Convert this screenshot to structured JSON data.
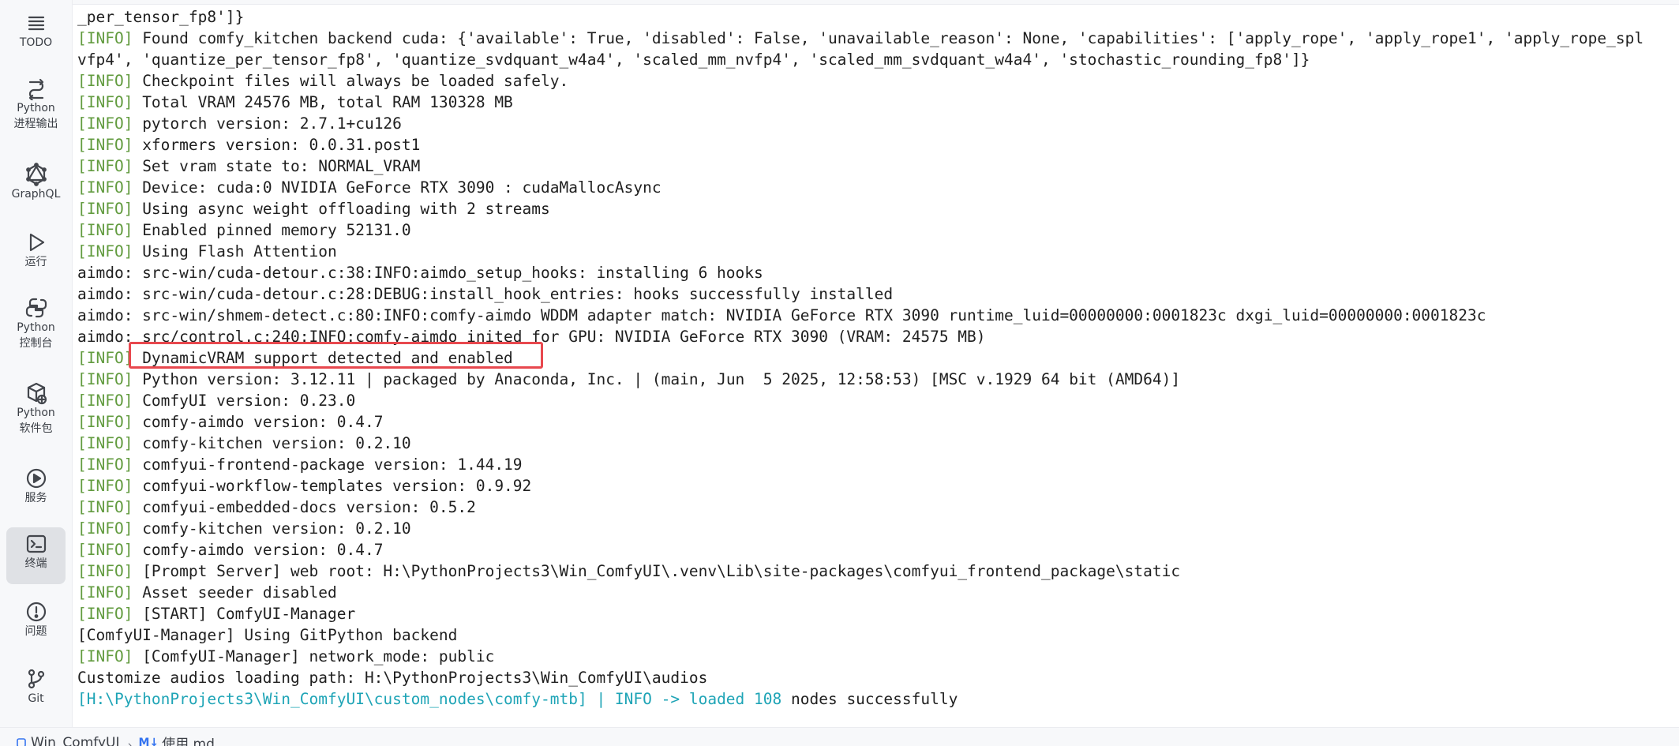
{
  "sidebar": {
    "items": [
      {
        "label": "TODO",
        "icon": "list-icon"
      },
      {
        "label": "Python\n进程输出",
        "icon": "python-process-output-icon"
      },
      {
        "label": "GraphQL",
        "icon": "graphql-icon"
      },
      {
        "label": "运行",
        "icon": "run-icon"
      },
      {
        "label": "Python\n控制台",
        "icon": "python-console-icon"
      },
      {
        "label": "Python\n软件包",
        "icon": "python-packages-icon"
      },
      {
        "label": "服务",
        "icon": "services-icon"
      },
      {
        "label": "终端",
        "icon": "terminal-icon"
      },
      {
        "label": "问题",
        "icon": "problems-icon"
      },
      {
        "label": "Git",
        "icon": "git-icon"
      }
    ]
  },
  "terminal": {
    "lines": [
      {
        "text": "_per_tensor_fp8']}"
      },
      {
        "tag": "[INFO]",
        "text": " Found comfy_kitchen backend cuda: {'available': True, 'disabled': False, 'unavailable_reason': None, 'capabilities': ['apply_rope', 'apply_rope1', 'apply_rope_spl"
      },
      {
        "text": "vfp4', 'quantize_per_tensor_fp8', 'quantize_svdquant_w4a4', 'scaled_mm_nvfp4', 'scaled_mm_svdquant_w4a4', 'stochastic_rounding_fp8']}"
      },
      {
        "tag": "[INFO]",
        "text": " Checkpoint files will always be loaded safely."
      },
      {
        "tag": "[INFO]",
        "text": " Total VRAM 24576 MB, total RAM 130328 MB"
      },
      {
        "tag": "[INFO]",
        "text": " pytorch version: 2.7.1+cu126"
      },
      {
        "tag": "[INFO]",
        "text": " xformers version: 0.0.31.post1"
      },
      {
        "tag": "[INFO]",
        "text": " Set vram state to: NORMAL_VRAM"
      },
      {
        "tag": "[INFO]",
        "text": " Device: cuda:0 NVIDIA GeForce RTX 3090 : cudaMallocAsync"
      },
      {
        "tag": "[INFO]",
        "text": " Using async weight offloading with 2 streams"
      },
      {
        "tag": "[INFO]",
        "text": " Enabled pinned memory 52131.0"
      },
      {
        "tag": "[INFO]",
        "text": " Using Flash Attention"
      },
      {
        "text": "aimdo: src-win/cuda-detour.c:38:INFO:aimdo_setup_hooks: installing 6 hooks"
      },
      {
        "text": "aimdo: src-win/cuda-detour.c:28:DEBUG:install_hook_entries: hooks successfully installed"
      },
      {
        "text": "aimdo: src-win/shmem-detect.c:80:INFO:comfy-aimdo WDDM adapter match: NVIDIA GeForce RTX 3090 runtime_luid=00000000:0001823c dxgi_luid=00000000:0001823c"
      },
      {
        "text": "aimdo: src/control.c:240:INFO:comfy-aimdo inited for GPU: NVIDIA GeForce RTX 3090 (VRAM: 24575 MB)"
      },
      {
        "tag": "[INFO]",
        "text": " DynamicVRAM support detected and enabled"
      },
      {
        "tag": "[INFO]",
        "text": " Python version: 3.12.11 | packaged by Anaconda, Inc. | (main, Jun  5 2025, 12:58:53) [MSC v.1929 64 bit (AMD64)]"
      },
      {
        "tag": "[INFO]",
        "text": " ComfyUI version: 0.23.0"
      },
      {
        "tag": "[INFO]",
        "text": " comfy-aimdo version: 0.4.7"
      },
      {
        "tag": "[INFO]",
        "text": " comfy-kitchen version: 0.2.10"
      },
      {
        "tag": "[INFO]",
        "text": " comfyui-frontend-package version: 1.44.19"
      },
      {
        "tag": "[INFO]",
        "text": " comfyui-workflow-templates version: 0.9.92"
      },
      {
        "tag": "[INFO]",
        "text": " comfyui-embedded-docs version: 0.5.2"
      },
      {
        "tag": "[INFO]",
        "text": " comfy-kitchen version: 0.2.10"
      },
      {
        "tag": "[INFO]",
        "text": " comfy-aimdo version: 0.4.7"
      },
      {
        "tag": "[INFO]",
        "text": " [Prompt Server] web root: H:\\PythonProjects3\\Win_ComfyUI\\.venv\\Lib\\site-packages\\comfyui_frontend_package\\static"
      },
      {
        "tag": "[INFO]",
        "text": " Asset seeder disabled"
      },
      {
        "tag": "[INFO]",
        "text": " [START] ComfyUI-Manager"
      },
      {
        "text": "[ComfyUI-Manager] Using GitPython backend"
      },
      {
        "tag": "[INFO]",
        "text": " [ComfyUI-Manager] network_mode: public"
      },
      {
        "text": "Customize audios loading path: H:\\PythonProjects3\\Win_ComfyUI\\audios"
      }
    ],
    "last_line": {
      "path": "[H:\\PythonProjects3\\Win_ComfyUI\\custom_nodes\\comfy-mtb]",
      "middle": " | INFO -> loaded ",
      "count": "108",
      "suffix": " nodes successfully"
    },
    "highlight_color": "#e8484e",
    "info_tag_color": "#629b3f"
  },
  "statusbar": {
    "project": "Win_ComfyUI",
    "file_badge": "M↓",
    "file": "使用.md"
  }
}
